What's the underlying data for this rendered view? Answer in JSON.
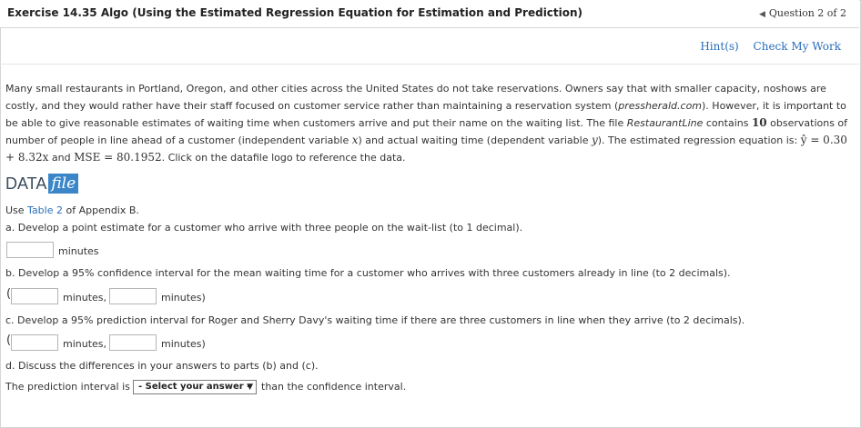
{
  "header": {
    "title": "Exercise 14.35 Algo (Using the Estimated Regression Equation for Estimation and Prediction)",
    "question_nav": "Question 2 of 2"
  },
  "links": {
    "hint": "Hint(s)",
    "check": "Check My Work"
  },
  "problem": {
    "p1": "Many small restaurants in Portland, Oregon, and other cities across the United States do not take reservations. Owners say that with smaller capacity, noshows are costly, and they would rather have their staff focused on customer service rather than maintaining a reservation system (",
    "source": "pressherald.com",
    "p2": "). However, it is important to be able to give reasonable estimates of waiting time when customers arrive and put their name on the waiting list. The file ",
    "file": "RestaurantLine",
    "p3": " contains ",
    "n": "10",
    "p4": " observations of number of people in line ahead of a customer (independent variable ",
    "xvar": "x",
    "p5": ") and actual waiting time (dependent variable ",
    "yvar": "y",
    "p6": "). The estimated regression equation is: ",
    "equation": "ŷ = 0.30 + 8.32x",
    "p7": " and ",
    "mse_label": "MSE = 80.1952",
    "p8": ". Click on the datafile logo to reference the data."
  },
  "datafile": {
    "data": "DATA",
    "file": "file"
  },
  "appendix": {
    "pre": "Use ",
    "link": "Table 2",
    "post": " of Appendix B."
  },
  "q_a": {
    "text": "a. Develop a point estimate for a customer who arrive with three people on the wait-list (to 1 decimal).",
    "unit": "minutes"
  },
  "q_b": {
    "text": "b. Develop a 95% confidence interval for the mean waiting time for a customer who arrives with three customers already in line (to 2 decimals).",
    "unit1": "minutes,",
    "unit2": "minutes)"
  },
  "q_c": {
    "text": "c. Develop a 95% prediction interval for Roger and Sherry Davy's waiting time if there are three customers in line when they arrive (to 2 decimals).",
    "unit1": "minutes,",
    "unit2": "minutes)"
  },
  "q_d": {
    "text": "d. Discuss the differences in your answers to parts (b) and (c).",
    "pre": "The prediction interval is",
    "select_value": "- Select your answer -",
    "post": "than the confidence interval."
  }
}
